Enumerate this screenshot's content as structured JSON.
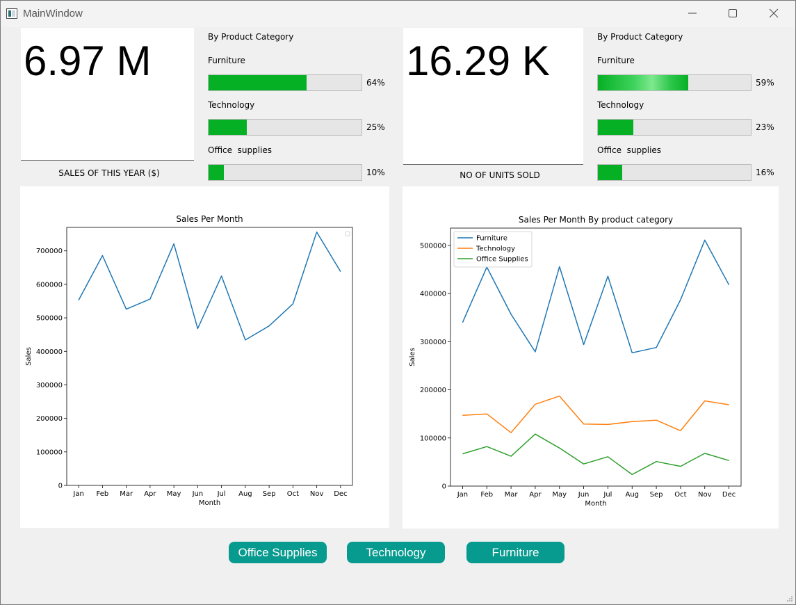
{
  "window": {
    "title": "MainWindow"
  },
  "sales_kpi": {
    "value": "6.97 M",
    "caption": "SALES OF THIS YEAR ($)"
  },
  "units_kpi": {
    "value": "16.29 K",
    "caption": "NO OF UNITS SOLD"
  },
  "sales_breakdown": {
    "title": "By Product Category",
    "items": [
      {
        "label": "Furniture",
        "percent": 64,
        "percent_text": "64%"
      },
      {
        "label": "Technology",
        "percent": 25,
        "percent_text": "25%"
      },
      {
        "label": "Office  supplies",
        "percent": 10,
        "percent_text": "10%"
      }
    ]
  },
  "units_breakdown": {
    "title": "By Product Category",
    "items": [
      {
        "label": "Furniture",
        "percent": 59,
        "percent_text": "59%"
      },
      {
        "label": "Technology",
        "percent": 23,
        "percent_text": "23%"
      },
      {
        "label": "Office  supplies",
        "percent": 16,
        "percent_text": "16%"
      }
    ]
  },
  "colors": {
    "bar_fill": "#06b025",
    "button": "#079a8e",
    "furniture": "#1f77b4",
    "technology": "#ff7f0e",
    "office_supplies": "#2ca02c"
  },
  "chart_data": [
    {
      "type": "line",
      "title": "Sales Per Month",
      "xlabel": "Month",
      "ylabel": "Sales",
      "categories": [
        "Jan",
        "Feb",
        "Mar",
        "Apr",
        "May",
        "Jun",
        "Jul",
        "Aug",
        "Sep",
        "Oct",
        "Nov",
        "Dec"
      ],
      "ylim": [
        0,
        770000
      ],
      "yticks": [
        0,
        100000,
        200000,
        300000,
        400000,
        500000,
        600000,
        700000
      ],
      "ytick_labels": [
        "0",
        "100000",
        "200000",
        "300000",
        "400000",
        "500000",
        "600000",
        "700000"
      ],
      "legend": "top-right (empty)",
      "series": [
        {
          "color": "#1f77b4",
          "values": [
            553000,
            686000,
            526000,
            556000,
            721000,
            468000,
            625000,
            434000,
            476000,
            542000,
            756000,
            638000
          ]
        }
      ]
    },
    {
      "type": "line",
      "title": "Sales Per Month By product category",
      "xlabel": "Month",
      "ylabel": "Sales",
      "categories": [
        "Jan",
        "Feb",
        "Mar",
        "Apr",
        "May",
        "Jun",
        "Jul",
        "Aug",
        "Sep",
        "Oct",
        "Nov",
        "Dec"
      ],
      "ylim": [
        0,
        536000
      ],
      "yticks": [
        0,
        100000,
        200000,
        300000,
        400000,
        500000
      ],
      "ytick_labels": [
        "0",
        "100000",
        "200000",
        "300000",
        "400000",
        "500000"
      ],
      "legend": "top-left",
      "series": [
        {
          "name": "Furniture",
          "color": "#1f77b4",
          "values": [
            340000,
            455000,
            357000,
            279000,
            456000,
            294000,
            436000,
            277000,
            288000,
            387000,
            511000,
            418000
          ]
        },
        {
          "name": "Technology",
          "color": "#ff7f0e",
          "values": [
            147000,
            150000,
            111000,
            170000,
            187000,
            129000,
            128000,
            134000,
            137000,
            115000,
            177000,
            169000
          ]
        },
        {
          "name": "Office Supplies",
          "color": "#2ca02c",
          "values": [
            67000,
            82000,
            62000,
            108000,
            79000,
            46000,
            61000,
            24000,
            51000,
            41000,
            68000,
            53000
          ]
        }
      ]
    }
  ],
  "buttons": {
    "office_supplies": "Office Supplies",
    "technology": "Technology",
    "furniture": "Furniture"
  }
}
